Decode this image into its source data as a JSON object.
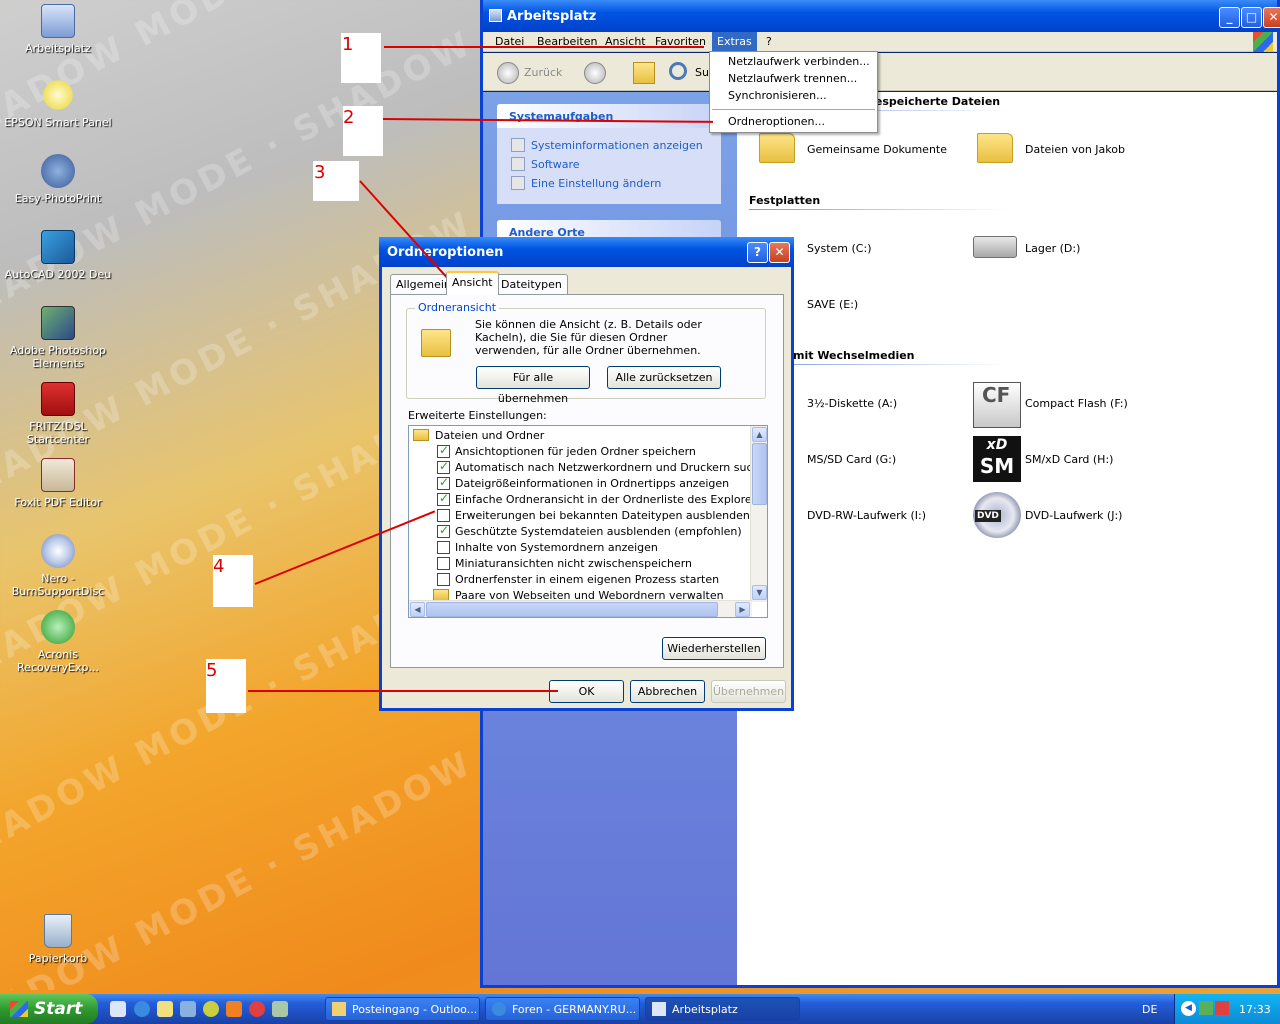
{
  "desktop": {
    "watermark": "SHADOW MODE · SHADOW MODE · SHADOW MODE",
    "icons": [
      {
        "label": "Arbeitsplatz"
      },
      {
        "label": "EPSON Smart Panel"
      },
      {
        "label": "Easy-PhotoPrint"
      },
      {
        "label": "AutoCAD 2002 Deu"
      },
      {
        "label": "Adobe Photoshop Elements"
      },
      {
        "label": "FRITZ!DSL Startcenter"
      },
      {
        "label": "Foxit PDF Editor"
      },
      {
        "label": "Nero - BurnSupportDisc"
      },
      {
        "label": "Acronis RecoveryExp..."
      },
      {
        "label": "Papierkorb"
      }
    ]
  },
  "explorer": {
    "title": "Arbeitsplatz",
    "menu": [
      "Datei",
      "Bearbeiten",
      "Ansicht",
      "Favoriten",
      "Extras",
      "?"
    ],
    "toolbar": {
      "back": "Zurück",
      "search": "Suc"
    },
    "tasks": {
      "header": "Systemaufgaben",
      "items": [
        "Systeminformationen anzeigen",
        "Software",
        "Eine Einstellung ändern"
      ],
      "other_header": "Andere Orte"
    },
    "sections": {
      "shared": "gespeicherte Dateien",
      "drives": "Festplatten",
      "removable": "mit Wechselmedien"
    },
    "items": {
      "shared_docs": "Gemeinsame Dokumente",
      "jakob": "Dateien von Jakob",
      "system_c": "System (C:)",
      "lager_d": "Lager (D:)",
      "save_e": "SAVE (E:)",
      "floppy_a": "3½-Diskette (A:)",
      "cf_f": "Compact Flash (F:)",
      "mssd_g": "MS/SD Card (G:)",
      "smxd_h": "SM/xD Card (H:)",
      "dvdrw_i": "DVD-RW-Laufwerk (I:)",
      "dvd_j": "DVD-Laufwerk (J:)"
    },
    "icon_text": {
      "cf": "CF",
      "xd": "xD",
      "sm": "SM",
      "dvd": "DVD"
    }
  },
  "extras_menu": [
    "Netzlaufwerk verbinden...",
    "Netzlaufwerk trennen...",
    "Synchronisieren...",
    "Ordneroptionen..."
  ],
  "dialog": {
    "title": "Ordneroptionen",
    "tabs": [
      "Allgemein",
      "Ansicht",
      "Dateitypen"
    ],
    "group_label": "Ordneransicht",
    "description": "Sie können die Ansicht (z. B. Details oder Kacheln), die Sie für diesen Ordner verwenden, für alle Ordner übernehmen.",
    "apply_all": "Für alle übernehmen",
    "reset_all": "Alle zurücksetzen",
    "advanced_label": "Erweiterte Einstellungen:",
    "tree": [
      {
        "type": "folder",
        "label": "Dateien und Ordner"
      },
      {
        "type": "check",
        "checked": true,
        "label": "Ansichtoptionen für jeden Ordner speichern"
      },
      {
        "type": "check",
        "checked": true,
        "label": "Automatisch nach Netzwerkordnern und Druckern suchen"
      },
      {
        "type": "check",
        "checked": true,
        "label": "Dateigrößeinformationen in Ordnertipps anzeigen"
      },
      {
        "type": "check",
        "checked": true,
        "label": "Einfache Ordneransicht in der Ordnerliste des Explorers anzeige"
      },
      {
        "type": "check",
        "checked": false,
        "label": "Erweiterungen bei bekannten Dateitypen ausblenden"
      },
      {
        "type": "check",
        "checked": true,
        "label": "Geschützte Systemdateien ausblenden (empfohlen)"
      },
      {
        "type": "check",
        "checked": false,
        "label": "Inhalte von Systemordnern anzeigen"
      },
      {
        "type": "check",
        "checked": false,
        "label": "Miniaturansichten nicht zwischenspeichern"
      },
      {
        "type": "check",
        "checked": false,
        "label": "Ordnerfenster in einem eigenen Prozess starten"
      },
      {
        "type": "folder",
        "label": "Paare von Webseiten und Webordnern verwalten"
      }
    ],
    "restore": "Wiederherstellen",
    "ok": "OK",
    "cancel": "Abbrechen",
    "apply": "Übernehmen"
  },
  "annotations": [
    "1",
    "2",
    "3",
    "4",
    "5"
  ],
  "taskbar": {
    "start": "Start",
    "windows": [
      "Posteingang - Outloo...",
      "Foren - GERMANY.RU...",
      "Arbeitsplatz"
    ],
    "lang": "DE",
    "time": "17:33"
  },
  "colors": {
    "annotation": "#dd0000",
    "title_blue": "#0054e3",
    "start_green": "#2f9a2f"
  }
}
